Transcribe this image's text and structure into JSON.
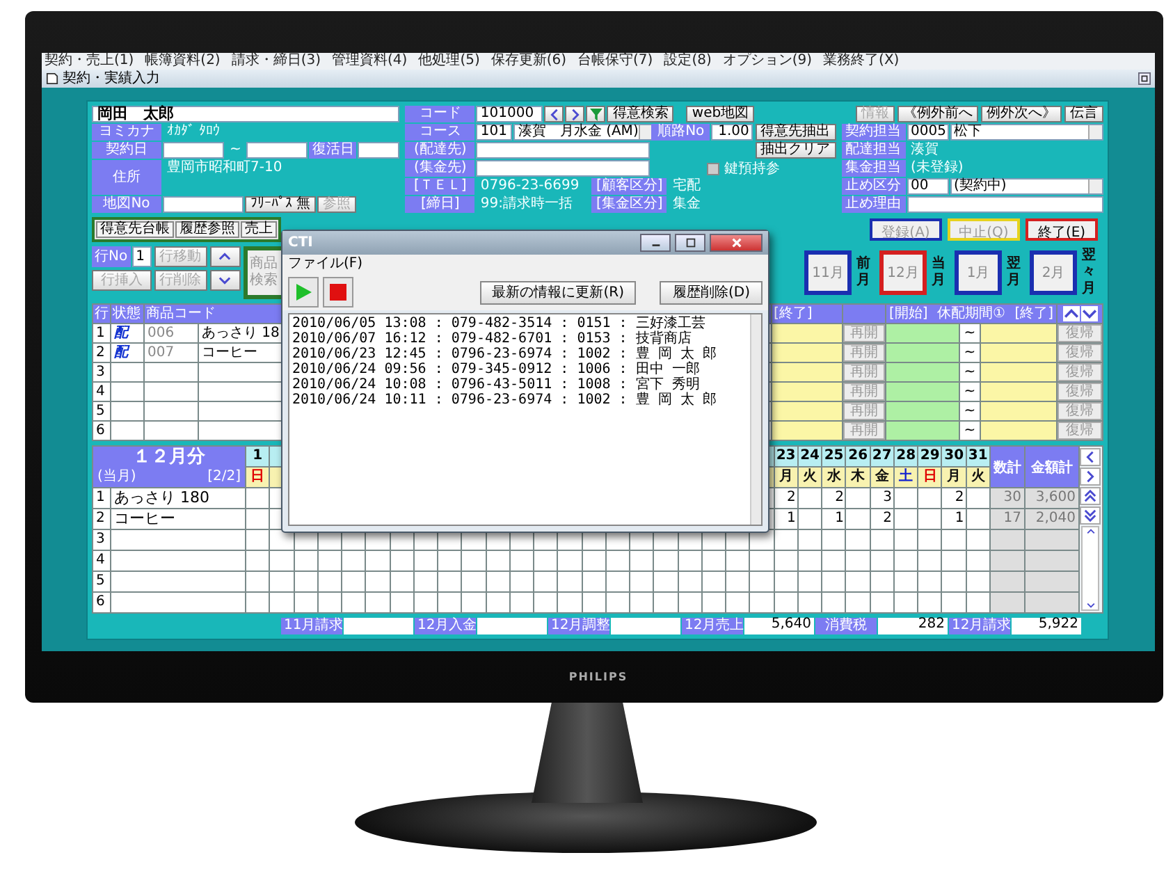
{
  "monitor": {
    "brand": "PHILIPS"
  },
  "menu": [
    "契約・売上(1)",
    "帳簿資料(2)",
    "請求・締日(3)",
    "管理資料(4)",
    "他処理(5)",
    "保存更新(6)",
    "台帳保守(7)",
    "設定(8)",
    "オプション(9)",
    "業務終了(X)"
  ],
  "window": {
    "title": "契約・実績入力"
  },
  "customer": {
    "name": "岡田　太郎",
    "kana_label": "ヨミカナ",
    "kana": "ｵｶﾀﾞ ﾀﾛｳ",
    "contract_label": "契約日",
    "range_sep": "~",
    "revival_label": "復活日",
    "address_label": "住所",
    "address": "豊岡市昭和町7-10",
    "map_label": "地図No",
    "free_pass_button": "ﾌﾘｰﾊﾟｽ 無",
    "ref_button": {
      "label": "参照",
      "disabled": true
    }
  },
  "code": {
    "label": "コード",
    "value": "101000",
    "search_button": "得意検索",
    "map_button": "web地図"
  },
  "course": {
    "label": "コース",
    "code": "101",
    "value": "湊賀　月水金 (AM)"
  },
  "delivery_label": "(配達先)",
  "collection_label": "(集金先)",
  "tel": {
    "label": "[ＴＥＬ]",
    "value": "0796-23-6699"
  },
  "closing": {
    "label": "[締日]",
    "value": "99:請求時一括"
  },
  "route": {
    "label": "順路No",
    "value": "1.00"
  },
  "extract_button": "得意先抽出",
  "clear_button": "抽出クリア",
  "key_checkbox": {
    "label": "鍵預持参",
    "checked": false
  },
  "customer_class": {
    "label": "[顧客区分]",
    "value": "宅配"
  },
  "collection_class": {
    "label": "[集金区分]",
    "value": "集金"
  },
  "nav_buttons": [
    {
      "label": "情報",
      "disabled": true
    },
    {
      "label": "《例外前へ",
      "disabled": false
    },
    {
      "label": "例外次へ》",
      "disabled": false
    },
    {
      "label": "伝言",
      "disabled": false
    }
  ],
  "staff": [
    {
      "label": "契約担当",
      "kind": "dropdown",
      "code": "0005",
      "value": "松下"
    },
    {
      "label": "配達担当",
      "kind": "text",
      "value": "湊賀"
    },
    {
      "label": "集金担当",
      "kind": "text",
      "value": "(未登録)"
    },
    {
      "label": "止め区分",
      "kind": "dropdown",
      "code": "00",
      "value": "(契約中)"
    },
    {
      "label": "止め理由",
      "kind": "field"
    }
  ],
  "tabs": [
    {
      "label": "得意先台帳",
      "selected": false
    },
    {
      "label": "履歴参照",
      "selected": false
    },
    {
      "label": "売上",
      "selected": false
    }
  ],
  "actions": [
    {
      "label": "登録(A)",
      "color": "#1a2fb0",
      "disabled": true
    },
    {
      "label": "中止(Q)",
      "color": "#e6d21e",
      "disabled": true
    },
    {
      "label": "終了(E)",
      "color": "#d42020",
      "disabled": false
    }
  ],
  "line_controls": {
    "row_label": "行No",
    "row_value": "1",
    "move_button": "行移動",
    "insert_button": "行挿入",
    "delete_button": "行削除",
    "product_search_button": "商品検索"
  },
  "months": [
    {
      "label": "11月",
      "caption": "前月",
      "selected": false
    },
    {
      "label": "12月",
      "caption": "当月",
      "selected": true
    },
    {
      "label": "1月",
      "caption": "翌月",
      "selected": false
    },
    {
      "label": "2月",
      "caption": "翌々月",
      "selected": false
    }
  ],
  "products": {
    "columns": [
      "行",
      "状態",
      "商品コード"
    ],
    "right_columns": [
      "[終了]",
      "[開始]",
      "休配期間①",
      "[終了]"
    ],
    "rows": [
      {
        "no": "1",
        "status": "配",
        "code": "006",
        "name": "あっさり 18",
        "resume_button": "再開",
        "range_sep": "~",
        "return_button": "復帰"
      },
      {
        "no": "2",
        "status": "配",
        "code": "007",
        "name": "コーヒー",
        "resume_button": "再開",
        "range_sep": "~",
        "return_button": "復帰"
      },
      {
        "no": "3",
        "resume_button": "再開",
        "range_sep": "~",
        "return_button": "復帰"
      },
      {
        "no": "4",
        "resume_button": "再開",
        "range_sep": "~",
        "return_button": "復帰"
      },
      {
        "no": "5",
        "resume_button": "再開",
        "range_sep": "~",
        "return_button": "復帰"
      },
      {
        "no": "6",
        "resume_button": "再開",
        "range_sep": "~",
        "return_button": "復帰"
      }
    ]
  },
  "calendar": {
    "title": "１２月分",
    "subtitle": "(当月)",
    "page": "[2/2]",
    "qty_label": "数計",
    "amount_label": "金額計",
    "days": [
      {
        "day": "1",
        "weekday": "日",
        "kind": "sunday"
      },
      {
        "day": "23",
        "weekday": "月",
        "kind": "weekday"
      },
      {
        "day": "24",
        "weekday": "火",
        "kind": "weekday"
      },
      {
        "day": "25",
        "weekday": "水",
        "kind": "weekday"
      },
      {
        "day": "26",
        "weekday": "木",
        "kind": "weekday"
      },
      {
        "day": "27",
        "weekday": "金",
        "kind": "weekday"
      },
      {
        "day": "28",
        "weekday": "土",
        "kind": "saturday"
      },
      {
        "day": "29",
        "weekday": "日",
        "kind": "sunday"
      },
      {
        "day": "30",
        "weekday": "月",
        "kind": "weekday"
      },
      {
        "day": "31",
        "weekday": "火",
        "kind": "weekday"
      }
    ],
    "rows": [
      {
        "no": "1",
        "name": "あっさり 180",
        "counts": {
          "23": "2",
          "25": "2",
          "27": "3",
          "30": "2"
        },
        "qty": "30",
        "amount": "3,600"
      },
      {
        "no": "2",
        "name": "コーヒー",
        "counts": {
          "23": "1",
          "25": "1",
          "27": "2",
          "30": "1"
        },
        "qty": "17",
        "amount": "2,040"
      },
      {
        "no": "3"
      },
      {
        "no": "4"
      },
      {
        "no": "5"
      },
      {
        "no": "6"
      }
    ]
  },
  "summary": [
    {
      "label": "11月請求"
    },
    {
      "label": "12月入金"
    },
    {
      "label": "12月調整"
    },
    {
      "label": "12月売上",
      "value": "5,640"
    },
    {
      "label": "消費税",
      "value": "282"
    },
    {
      "label": "12月請求",
      "value": "5,922"
    }
  ],
  "cti": {
    "title": "CTI",
    "menu": "ファイル(F)",
    "refresh_button": "最新の情報に更新(R)",
    "delete_button": "履歴削除(D)",
    "log": [
      "2010/06/05 13:08 : 079-482-3514 : 0151 : 三好漆工芸",
      "2010/06/07 16:12 : 079-482-6701 : 0153 : 技背商店",
      "2010/06/23 12:45 : 0796-23-6974 : 1002 : 豊 岡 太 郎",
      "2010/06/24 09:56 : 079-345-0912 : 1006 : 田中 一郎",
      "2010/06/24 10:08 : 0796-43-5011 : 1008 : 宮下 秀明",
      "2010/06/24 10:11 : 0796-23-6974 : 1002 : 豊 岡 太 郎"
    ]
  }
}
